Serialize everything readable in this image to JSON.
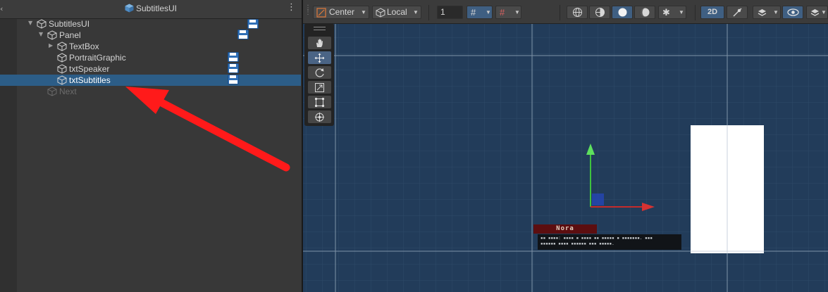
{
  "hierarchy": {
    "title": "SubtitlesUI",
    "items": [
      {
        "label": "SubtitlesUI"
      },
      {
        "label": "Panel"
      },
      {
        "label": "TextBox"
      },
      {
        "label": "PortraitGraphic"
      },
      {
        "label": "txtSpeaker"
      },
      {
        "label": "txtSubtitles"
      },
      {
        "label": "Next"
      }
    ]
  },
  "toolbar": {
    "pivot": "Center",
    "space": "Local",
    "grid_value": "1",
    "mode_2d": "2D"
  },
  "scene": {
    "speaker_name": "Nora",
    "subtitle_line1": "▪▪ ▪▪▪▪: ▪▪▪▪ ▪ ▪▪▪▪ ▪▪ ▪▪▪▪▪ ▪ ▪▪▪▪▪▪▪. ▪▪▪",
    "subtitle_line2": "▪▪▪▪▪▪ ▪▪▪▪ ▪▪▪▪▪▪ ▪▪▪ ▪▪▪▪▪."
  },
  "colors": {
    "selection": "#2c5d87",
    "annotation_arrow": "#ff1a1a",
    "scene_bg": "#223c5a"
  }
}
